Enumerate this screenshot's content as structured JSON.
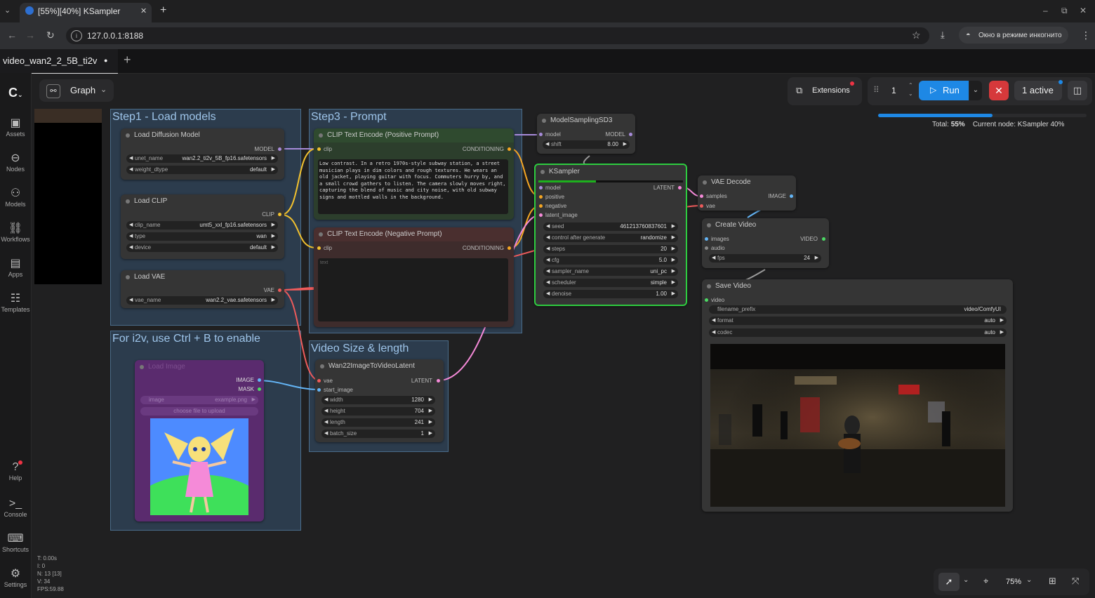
{
  "browser": {
    "tab_title": "[55%][40%] KSampler",
    "close_glyph": "✕",
    "new_tab_glyph": "+",
    "url": "127.0.0.1:8188",
    "incognito": "Окно в режиме инкогнито",
    "window_min": "–",
    "window_restore": "⧉",
    "window_close": "✕"
  },
  "workflow_tab": {
    "name": "video_wan2_2_5B_ti2v",
    "modified_marker": "●",
    "add": "+"
  },
  "toolbar": {
    "graph_label": "Graph",
    "extensions_label": "Extensions",
    "queue_count": "1",
    "run_label": "Run",
    "cancel_glyph": "✕",
    "active_label": "1 active",
    "progress": {
      "total_label": "Total:",
      "total_value": "55%",
      "current_label": "Current node: KSampler 40%",
      "total_fraction": 0.55
    }
  },
  "sidebar": {
    "items": [
      {
        "label": "Assets",
        "icon": "image-icon"
      },
      {
        "label": "Nodes",
        "icon": "node-icon"
      },
      {
        "label": "Models",
        "icon": "models-icon"
      },
      {
        "label": "Workflows",
        "icon": "workflow-icon"
      },
      {
        "label": "Apps",
        "icon": "apps-icon"
      },
      {
        "label": "Templates",
        "icon": "templates-icon"
      },
      {
        "label": "Help",
        "icon": "help-icon"
      },
      {
        "label": "Console",
        "icon": "console-icon"
      },
      {
        "label": "Shortcuts",
        "icon": "keyboard-icon"
      },
      {
        "label": "Settings",
        "icon": "gear-icon"
      }
    ]
  },
  "stats": {
    "t": "T: 0.00s",
    "i": "I: 0",
    "n": "N: 13 [13]",
    "v": "V: 34",
    "fps": "FPS:59.88"
  },
  "groups": {
    "step1": "Step1 - Load models",
    "step3": "Step3 - Prompt",
    "i2v": "For i2v, use Ctrl + B to enable",
    "video": "Video Size & length"
  },
  "nodes": {
    "diffusion": {
      "title": "Load Diffusion Model",
      "out": "MODEL",
      "w1l": "unet_name",
      "w1v": "wan2.2_ti2v_5B_fp16.safetensors",
      "w2l": "weight_dtype",
      "w2v": "default"
    },
    "clip": {
      "title": "Load CLIP",
      "out": "CLIP",
      "w1l": "clip_name",
      "w1v": "umt5_xxl_fp16.safetensors",
      "w2l": "type",
      "w2v": "wan",
      "w3l": "device",
      "w3v": "default"
    },
    "vae": {
      "title": "Load VAE",
      "out": "VAE",
      "w1l": "vae_name",
      "w1v": "wan2.2_vae.safetensors"
    },
    "pos": {
      "title": "CLIP Text Encode (Positive Prompt)",
      "in": "clip",
      "out": "CONDITIONING",
      "text": "Low contrast. In a retro 1970s-style subway station, a street musician plays in dim colors and rough textures. He wears an old jacket, playing guitar with focus. Commuters hurry by, and a small crowd gathers to listen. The camera slowly moves right, capturing the blend of music and city noise, with old subway signs and mottled walls in the background."
    },
    "neg": {
      "title": "CLIP Text Encode (Negative Prompt)",
      "in": "clip",
      "out": "CONDITIONING",
      "placeholder": "text"
    },
    "msd": {
      "title": "ModelSamplingSD3",
      "in": "model",
      "out": "MODEL",
      "w1l": "shift",
      "w1v": "8.00"
    },
    "ks": {
      "title": "KSampler",
      "in1": "model",
      "in2": "positive",
      "in3": "negative",
      "in4": "latent_image",
      "out": "LATENT",
      "widgets": [
        {
          "l": "seed",
          "v": "461213760837601"
        },
        {
          "l": "control after generate",
          "v": "randomize"
        },
        {
          "l": "steps",
          "v": "20"
        },
        {
          "l": "cfg",
          "v": "5.0"
        },
        {
          "l": "sampler_name",
          "v": "uni_pc"
        },
        {
          "l": "scheduler",
          "v": "simple"
        },
        {
          "l": "denoise",
          "v": "1.00"
        }
      ],
      "progress": 0.4
    },
    "vaed": {
      "title": "VAE Decode",
      "in1": "samples",
      "in2": "vae",
      "out": "IMAGE"
    },
    "cv": {
      "title": "Create Video",
      "in1": "images",
      "in2": "audio",
      "out": "VIDEO",
      "w1l": "fps",
      "w1v": "24"
    },
    "sv": {
      "title": "Save Video",
      "in1": "video",
      "w1l": "filename_prefix",
      "w1v": "video/ComfyUI",
      "w2l": "format",
      "w2v": "auto",
      "w3l": "codec",
      "w3v": "auto"
    },
    "li": {
      "title": "Load Image",
      "out1": "IMAGE",
      "out2": "MASK",
      "w1l": "image",
      "w1v": "example.png",
      "upload": "choose file to upload"
    },
    "wan": {
      "title": "Wan22ImageToVideoLatent",
      "in1": "vae",
      "in2": "start_image",
      "out": "LATENT",
      "widgets": [
        {
          "l": "width",
          "v": "1280"
        },
        {
          "l": "height",
          "v": "704"
        },
        {
          "l": "length",
          "v": "241"
        },
        {
          "l": "batch_size",
          "v": "1"
        }
      ]
    }
  },
  "zoom": {
    "value": "75%"
  },
  "colors": {
    "accent": "#1e88e5",
    "ks_border": "#2ecc40",
    "group": "#3c5f82",
    "pos_title": "#2b4a2b",
    "neg_title": "#4a2b2b"
  }
}
